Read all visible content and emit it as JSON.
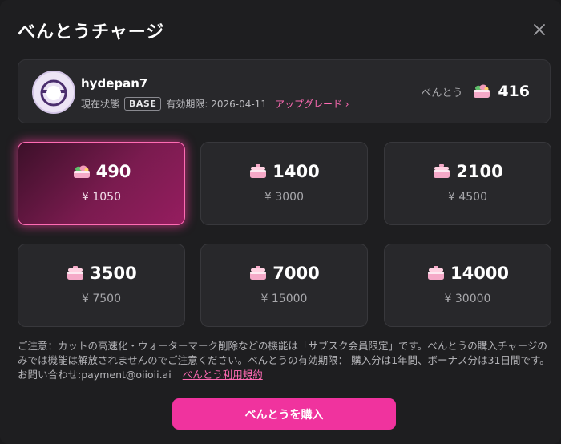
{
  "dialog": {
    "title": "べんとうチャージ"
  },
  "user": {
    "name": "hydepan7",
    "status_label": "現在状態",
    "plan_badge": "BASE",
    "expiry_text": "有効期限: 2026-04-11",
    "upgrade_label": "アップグレード ›",
    "balance_label": "べんとう",
    "balance_value": "416"
  },
  "packages": [
    {
      "amount": "490",
      "price": "¥ 1050",
      "selected": true
    },
    {
      "amount": "1400",
      "price": "¥ 3000",
      "selected": false
    },
    {
      "amount": "2100",
      "price": "¥ 4500",
      "selected": false
    },
    {
      "amount": "3500",
      "price": "¥ 7500",
      "selected": false
    },
    {
      "amount": "7000",
      "price": "¥ 15000",
      "selected": false
    },
    {
      "amount": "14000",
      "price": "¥ 30000",
      "selected": false
    }
  ],
  "notice": {
    "text": "ご注意：カットの高速化・ウォーターマーク削除などの機能は「サブスク会員限定」です。べんとうの購入チャージのみでは機能は解放されませんのでご注意ください。べんとうの有効期限： 購入分は1年間、ボーナス分は31日間です。お問い合わせ:payment@oiioii.ai",
    "terms_link": "べんとう利用規約"
  },
  "actions": {
    "buy_label": "べんとうを購入"
  },
  "icons": {
    "close": "close-icon",
    "bento": "bento-box-icon",
    "avatar": "avatar-icon"
  },
  "colors": {
    "accent": "#f0339e",
    "link": "#ff6bb4",
    "selected_border": "#ff6bb4"
  }
}
